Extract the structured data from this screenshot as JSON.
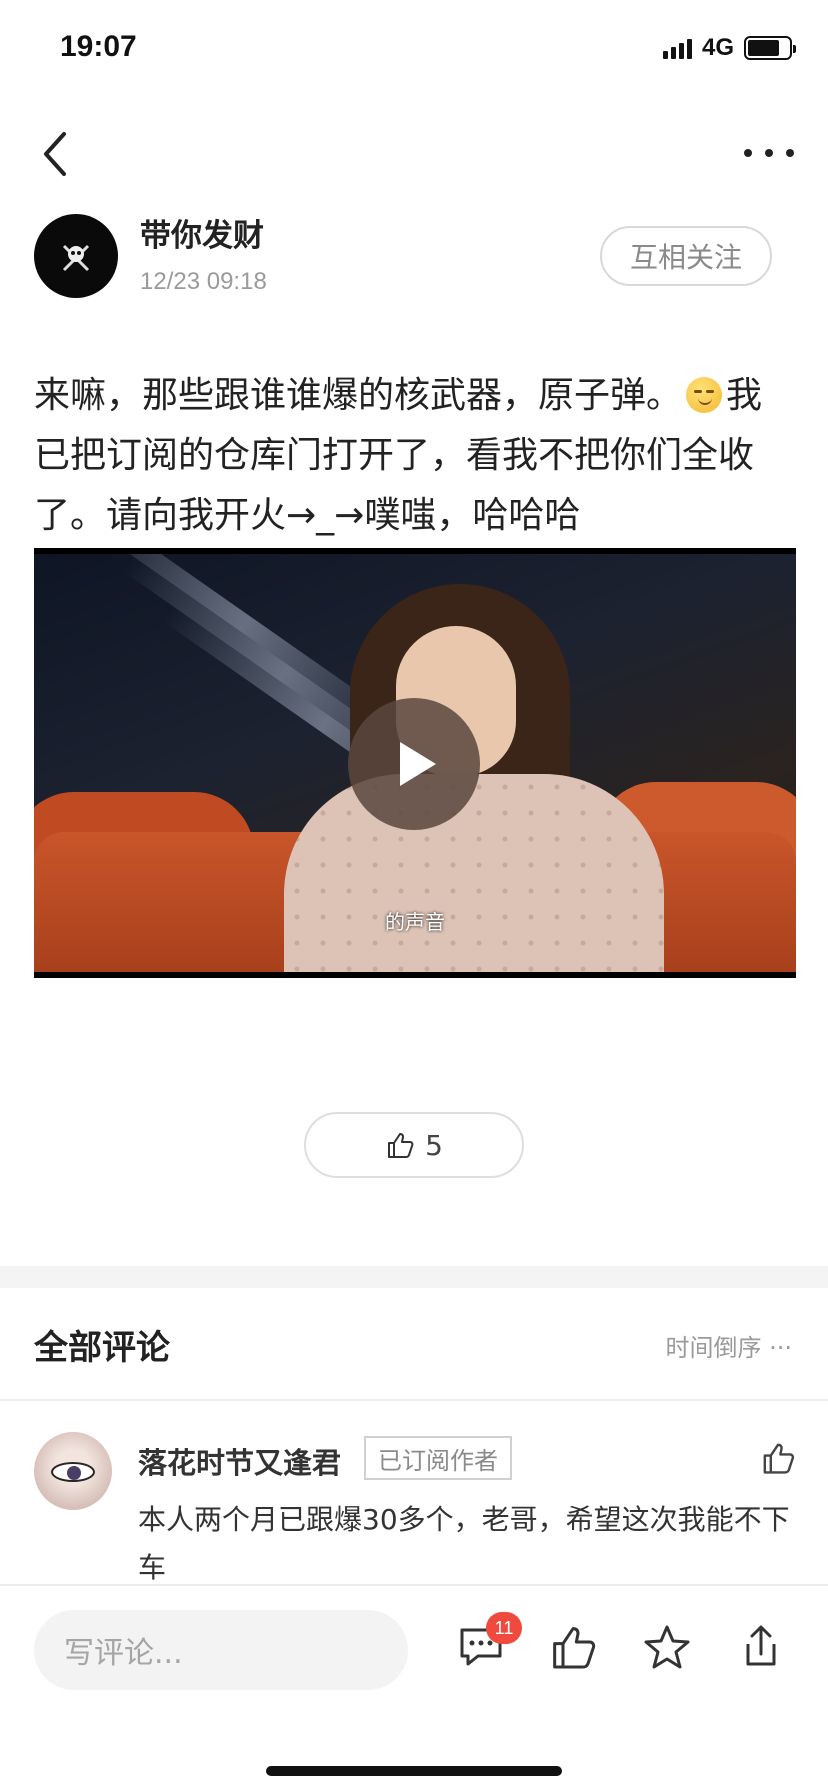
{
  "status_bar": {
    "time": "19:07",
    "network": "4G"
  },
  "author": {
    "name": "带你发财",
    "time": "12/23 09:18",
    "follow_label": "互相关注"
  },
  "post": {
    "text_part1": "来嘛，那些跟谁谁爆的核武器，原子弹。",
    "text_part2": "我已把订阅的仓库门打开了，看我不把你们全收了。请向我开火→_→噗嗤，哈哈哈",
    "emoji": "smirk-emoji",
    "video_subtitle": "的声音"
  },
  "like": {
    "count": "5"
  },
  "comments": {
    "title": "全部评论",
    "sort_label": "时间倒序 ···",
    "items": [
      {
        "name": "落花时节又逢君",
        "badge": "已订阅作者",
        "text": "本人两个月已跟爆30多个，老哥，希望这次我能不下车"
      }
    ]
  },
  "bottom_bar": {
    "input_placeholder": "写评论...",
    "comment_count": "11"
  }
}
